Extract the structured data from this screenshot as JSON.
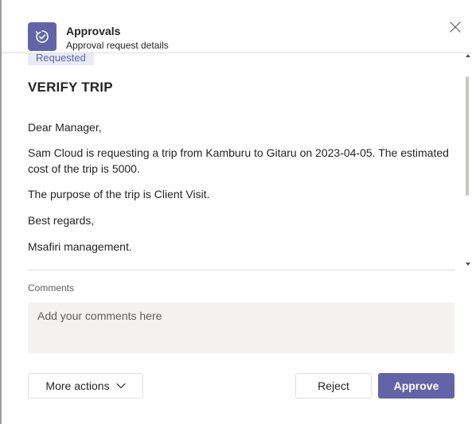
{
  "header": {
    "app_name": "Approvals",
    "subtitle": "Approval request details",
    "app_icon": "approvals-icon",
    "close_icon": "close-icon"
  },
  "card": {
    "status": "Requested",
    "title": "VERIFY TRIP",
    "paragraphs": [
      "Dear Manager,",
      "Sam Cloud is requesting a trip from Kamburu to Gitaru on 2023-04-05. The estimated cost of the trip is 5000.",
      "The purpose of the trip is Client Visit.",
      "Best regards,",
      "Msafiri management."
    ]
  },
  "comments": {
    "label": "Comments",
    "placeholder": "Add your comments here",
    "value": ""
  },
  "actions": {
    "more_actions_label": "More actions",
    "reject_label": "Reject",
    "approve_label": "Approve"
  },
  "colors": {
    "accent": "#6264a7",
    "status_badge_bg": "#e8ebfa",
    "input_bg": "#f3f2f1",
    "divider": "#e1dfdd"
  }
}
